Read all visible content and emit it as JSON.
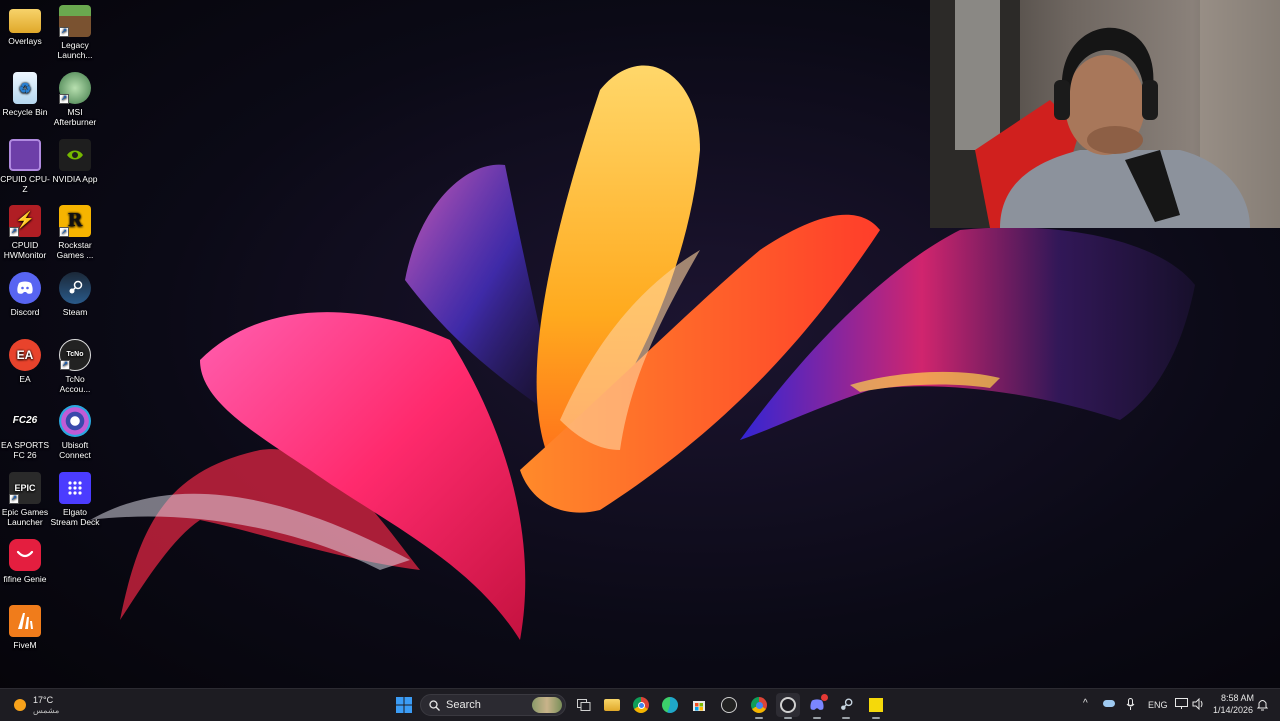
{
  "desktop": {
    "icons": [
      {
        "label": "Overlays",
        "icon": "folder-icon",
        "color": "#f1c232"
      },
      {
        "label": "Legacy Launch...",
        "icon": "minecraft-icon",
        "color": "#5a8a3a"
      },
      {
        "label": "Recycle Bin",
        "icon": "recycle-bin-icon",
        "color": "#cfe6f5"
      },
      {
        "label": "MSI Afterburner",
        "icon": "msi-afterburner-icon",
        "color": "#3f7a48"
      },
      {
        "label": "CPUID CPU-Z",
        "icon": "cpuz-icon",
        "color": "#6d3fa8"
      },
      {
        "label": "NVIDIA App",
        "icon": "nvidia-icon",
        "color": "#1e1e1e"
      },
      {
        "label": "CPUID HWMonitor",
        "icon": "hwmonitor-icon",
        "color": "#b01e24"
      },
      {
        "label": "Rockstar Games ...",
        "icon": "rockstar-icon",
        "color": "#f6b400"
      },
      {
        "label": "Discord",
        "icon": "discord-icon",
        "color": "#5865f2"
      },
      {
        "label": "Steam",
        "icon": "steam-icon",
        "color": "#1b2838"
      },
      {
        "label": "EA",
        "icon": "ea-icon",
        "color": "#e8432c"
      },
      {
        "label": "TcNo Accou...",
        "icon": "tcno-icon",
        "color": "#222222"
      },
      {
        "label": "EA SPORTS FC 26",
        "icon": "easports-fc-icon",
        "color": "#1a1a1a"
      },
      {
        "label": "Ubisoft Connect",
        "icon": "ubisoft-icon",
        "color": "#3949ab"
      },
      {
        "label": "Epic Games Launcher",
        "icon": "epic-games-icon",
        "color": "#2a2a2a"
      },
      {
        "label": "Elgato Stream Deck",
        "icon": "stream-deck-icon",
        "color": "#4b3cff"
      },
      {
        "label": "fifine Genie",
        "icon": "fifine-icon",
        "color": "#e41e3f"
      },
      {
        "label": "FiveM",
        "icon": "fivem-icon",
        "color": "#f07c1b"
      }
    ],
    "icon_glyphs": {
      "ea": "EA",
      "fc": "FC26",
      "epic": "EPIC",
      "rockstar": "R",
      "tcno": "TcNo"
    }
  },
  "taskbar": {
    "weather": {
      "temp": "17°C",
      "condition": "مشمس"
    },
    "search_placeholder": "Search",
    "apps": [
      {
        "name": "windows-start-icon",
        "color": "#3b9cf5"
      },
      {
        "name": "search"
      },
      {
        "name": "search-highlight-icon",
        "color": "#c9b38a"
      },
      {
        "name": "task-view-icon",
        "color": "#cfcfcf"
      },
      {
        "name": "file-explorer-icon",
        "color": "#f3c03e"
      },
      {
        "name": "chrome-icon",
        "color": "#db4437"
      },
      {
        "name": "edge-icon",
        "color": "#1fa7c9"
      },
      {
        "name": "microsoft-store-icon",
        "color": "#e8e8e8"
      },
      {
        "name": "tcno-taskbar-icon",
        "color": "#cfcfcf"
      },
      {
        "name": "chrome-profile-icon",
        "color": "#4285f4"
      },
      {
        "name": "obs-icon",
        "color": "#d0d0d0"
      },
      {
        "name": "discord-taskbar-icon",
        "color": "#5865f2"
      },
      {
        "name": "steam-taskbar-icon",
        "color": "#c7d5e0"
      },
      {
        "name": "pinned-app-yellow-icon",
        "color": "#f5d90a"
      }
    ],
    "tray": {
      "language": "ENG",
      "time": "8:58 AM",
      "date": "1/14/2026"
    }
  }
}
